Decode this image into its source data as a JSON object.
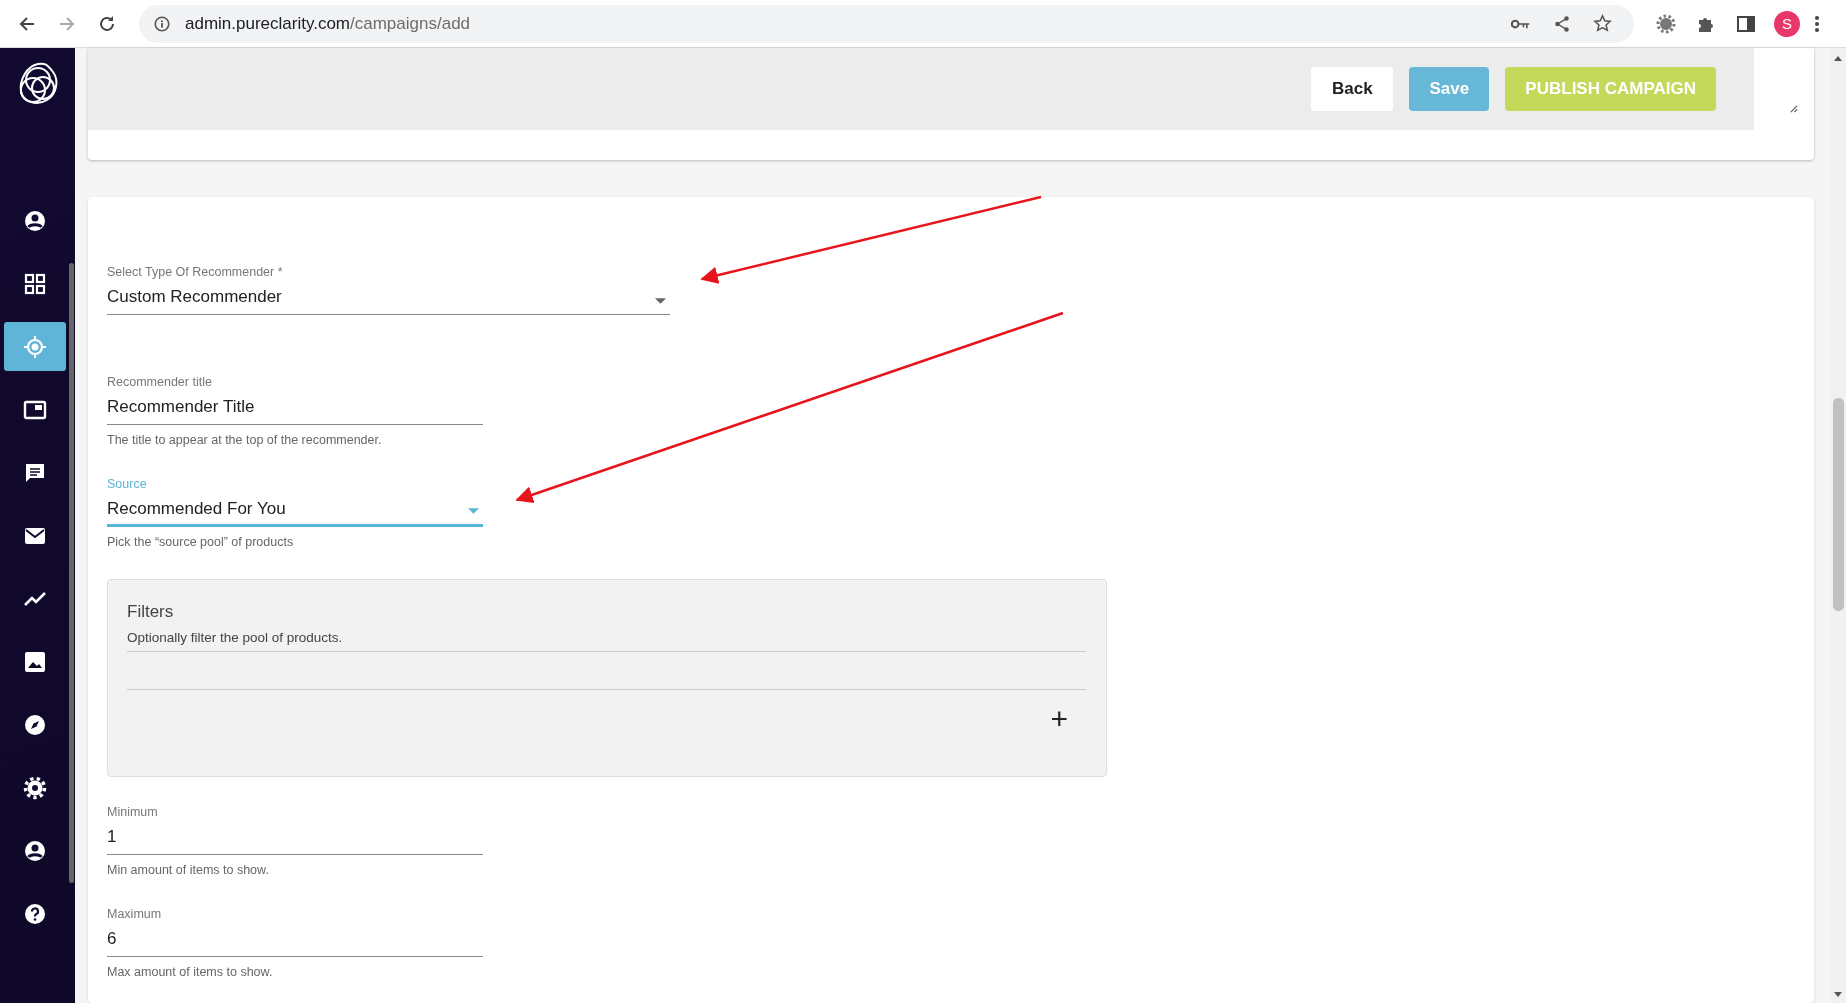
{
  "browser": {
    "url_host": "admin.pureclarity.com",
    "url_path": "/campaigns/add",
    "profile_initial": "S"
  },
  "sidebar": {
    "items": [
      {
        "kind": "person",
        "selected": false
      },
      {
        "kind": "grid",
        "selected": false
      },
      {
        "kind": "target",
        "selected": true
      },
      {
        "kind": "screen",
        "selected": false
      },
      {
        "kind": "chat",
        "selected": false
      },
      {
        "kind": "mail",
        "selected": false
      },
      {
        "kind": "trend",
        "selected": false
      },
      {
        "kind": "image",
        "selected": false
      },
      {
        "kind": "compass",
        "selected": false
      },
      {
        "kind": "gear",
        "selected": false
      },
      {
        "kind": "account",
        "selected": false
      },
      {
        "kind": "help",
        "selected": false
      }
    ]
  },
  "actions": [
    {
      "label": "Back",
      "kind": "plain"
    },
    {
      "label": "Save",
      "kind": "save"
    },
    {
      "label": "PUBLISH CAMPAIGN",
      "kind": "publish"
    }
  ],
  "form": {
    "recommender_type": {
      "label": "Select Type Of Recommender *",
      "value": "Custom Recommender"
    },
    "title": {
      "label": "Recommender title",
      "value": "Recommender Title",
      "help": "The title to appear at the top of the recommender."
    },
    "source": {
      "label": "Source",
      "value": "Recommended For You",
      "help": "Pick the “source pool” of products",
      "focused": true
    },
    "filters": {
      "title": "Filters",
      "description": "Optionally filter the pool of products.",
      "add_symbol": "+"
    },
    "minimum": {
      "label": "Minimum",
      "value": "1",
      "help": "Min amount of items to show."
    },
    "maximum": {
      "label": "Maximum",
      "value": "6",
      "help": "Max amount of items to show."
    }
  }
}
